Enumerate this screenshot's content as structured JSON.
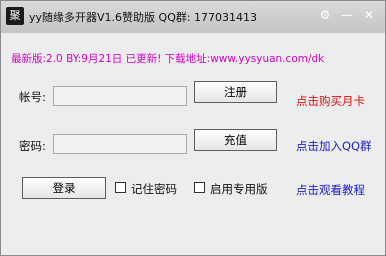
{
  "window": {
    "title": "yy随缘多开器V1.6赞助版 QQ群: 177031413",
    "icon_glyph": "聚",
    "controls": {
      "gear": "⚙",
      "minimize": "—",
      "close": "✕"
    }
  },
  "notice": "最新版:2.0 BY:9月21日 已更新! 下载地址:www.yysyuan.com/dk",
  "form": {
    "account_label": "帐号:",
    "account_value": "",
    "register_button": "注册",
    "buy_card_link": "点击购买月卡",
    "password_label": "密码:",
    "password_value": "",
    "recharge_button": "充值",
    "join_qq_link": "点击加入QQ群",
    "login_button": "登录",
    "remember_password_label": "记住密码",
    "remember_password_checked": false,
    "dedicated_mode_label": "启用专用版",
    "dedicated_mode_checked": false,
    "tutorial_link": "点击观看教程"
  },
  "colors": {
    "notice": "#d400c8",
    "red_link": "#e01010",
    "blue_link": "#1a1ad0"
  }
}
